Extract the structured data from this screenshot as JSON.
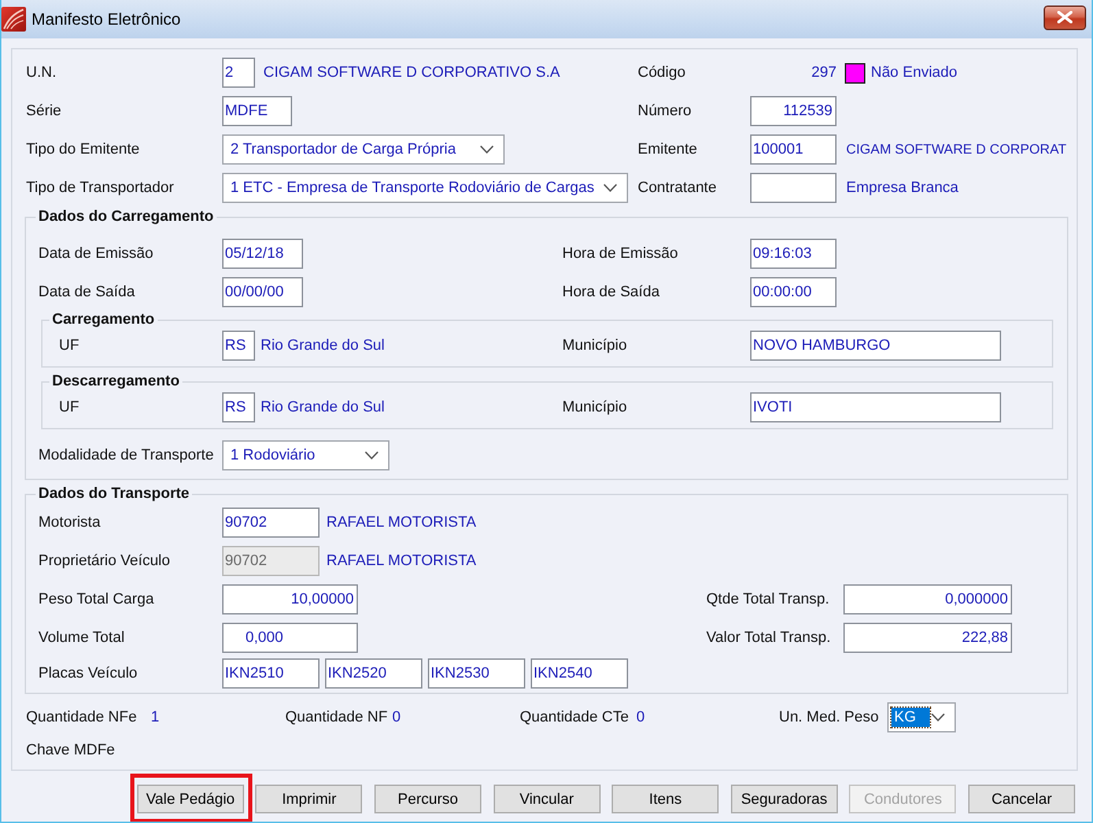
{
  "window": {
    "title": "Manifesto Eletrônico"
  },
  "general": {
    "un": {
      "label": "U.N.",
      "value": "2",
      "description": "CIGAM SOFTWARE D CORPORATIVO S.A"
    },
    "serie": {
      "label": "Série",
      "value": "MDFE"
    },
    "tipo_emitente": {
      "label": "Tipo do Emitente",
      "value": "2 Transportador de Carga Própria"
    },
    "tipo_transportador": {
      "label": "Tipo de Transportador",
      "value": "1 ETC - Empresa de Transporte Rodoviário de Cargas"
    },
    "codigo": {
      "label": "Código",
      "value": "297",
      "color": "#ff00ff",
      "status": "Não Enviado"
    },
    "numero": {
      "label": "Número",
      "value": "112539"
    },
    "emitente": {
      "label": "Emitente",
      "value": "100001",
      "description": "CIGAM SOFTWARE D CORPORAT"
    },
    "contratante": {
      "label": "Contratante",
      "description": "Empresa Branca"
    }
  },
  "carregamento": {
    "title": "Dados do Carregamento",
    "data_emissao": {
      "label": "Data de Emissão",
      "value": "05/12/18"
    },
    "hora_emissao": {
      "label": "Hora de Emissão",
      "value": "09:16:03"
    },
    "data_saida": {
      "label": "Data de Saída",
      "value": "00/00/00"
    },
    "hora_saida": {
      "label": "Hora de Saída",
      "value": "00:00:00"
    },
    "locais": [
      {
        "title": "Carregamento",
        "uf_label": "UF",
        "uf": "RS",
        "estado": "Rio Grande do Sul",
        "municipio_label": "Município",
        "municipio": "NOVO HAMBURGO"
      },
      {
        "title": "Descarregamento",
        "uf_label": "UF",
        "uf": "RS",
        "estado": "Rio Grande do Sul",
        "municipio_label": "Município",
        "municipio": "IVOTI"
      }
    ],
    "modalidade": {
      "label": "Modalidade de Transporte",
      "value": "1 Rodoviário"
    }
  },
  "transporte": {
    "title": "Dados do Transporte",
    "motorista": {
      "label": "Motorista",
      "value": "90702",
      "description": "RAFAEL MOTORISTA",
      "disabled": false
    },
    "proprietario": {
      "label": "Proprietário Veículo",
      "value": "90702",
      "description": "RAFAEL MOTORISTA",
      "disabled": true
    },
    "peso": {
      "label": "Peso Total Carga",
      "value": "10,00000"
    },
    "qtde": {
      "label": "Qtde Total Transp.",
      "value": "0,000000"
    },
    "volume": {
      "label": "Volume Total",
      "value": "0,000"
    },
    "valor": {
      "label": "Valor Total Transp.",
      "value": "222,88"
    },
    "placas": {
      "label": "Placas Veículo",
      "values": [
        "IKN2510",
        "IKN2520",
        "IKN2530",
        "IKN2540"
      ]
    }
  },
  "totals": [
    {
      "label": "Quantidade NFe",
      "value": "1"
    },
    {
      "label": "Quantidade NF",
      "value": "0"
    },
    {
      "label": "Quantidade CTe",
      "value": "0"
    }
  ],
  "unidade_peso": {
    "label": "Un. Med. Peso",
    "value": "KG",
    "focused": true
  },
  "chave": {
    "label": "Chave MDFe"
  },
  "buttons": [
    {
      "label": "Vale Pedágio",
      "disabled": false,
      "highlighted": true
    },
    {
      "label": "Imprimir",
      "disabled": false,
      "highlighted": false
    },
    {
      "label": "Percurso",
      "disabled": false,
      "highlighted": false
    },
    {
      "label": "Vincular",
      "disabled": false,
      "highlighted": false
    },
    {
      "label": "Itens",
      "disabled": false,
      "highlighted": false
    },
    {
      "label": "Seguradoras",
      "disabled": false,
      "highlighted": false
    },
    {
      "label": "Condutores",
      "disabled": true,
      "highlighted": false
    },
    {
      "label": "Cancelar",
      "disabled": false,
      "highlighted": false
    }
  ]
}
